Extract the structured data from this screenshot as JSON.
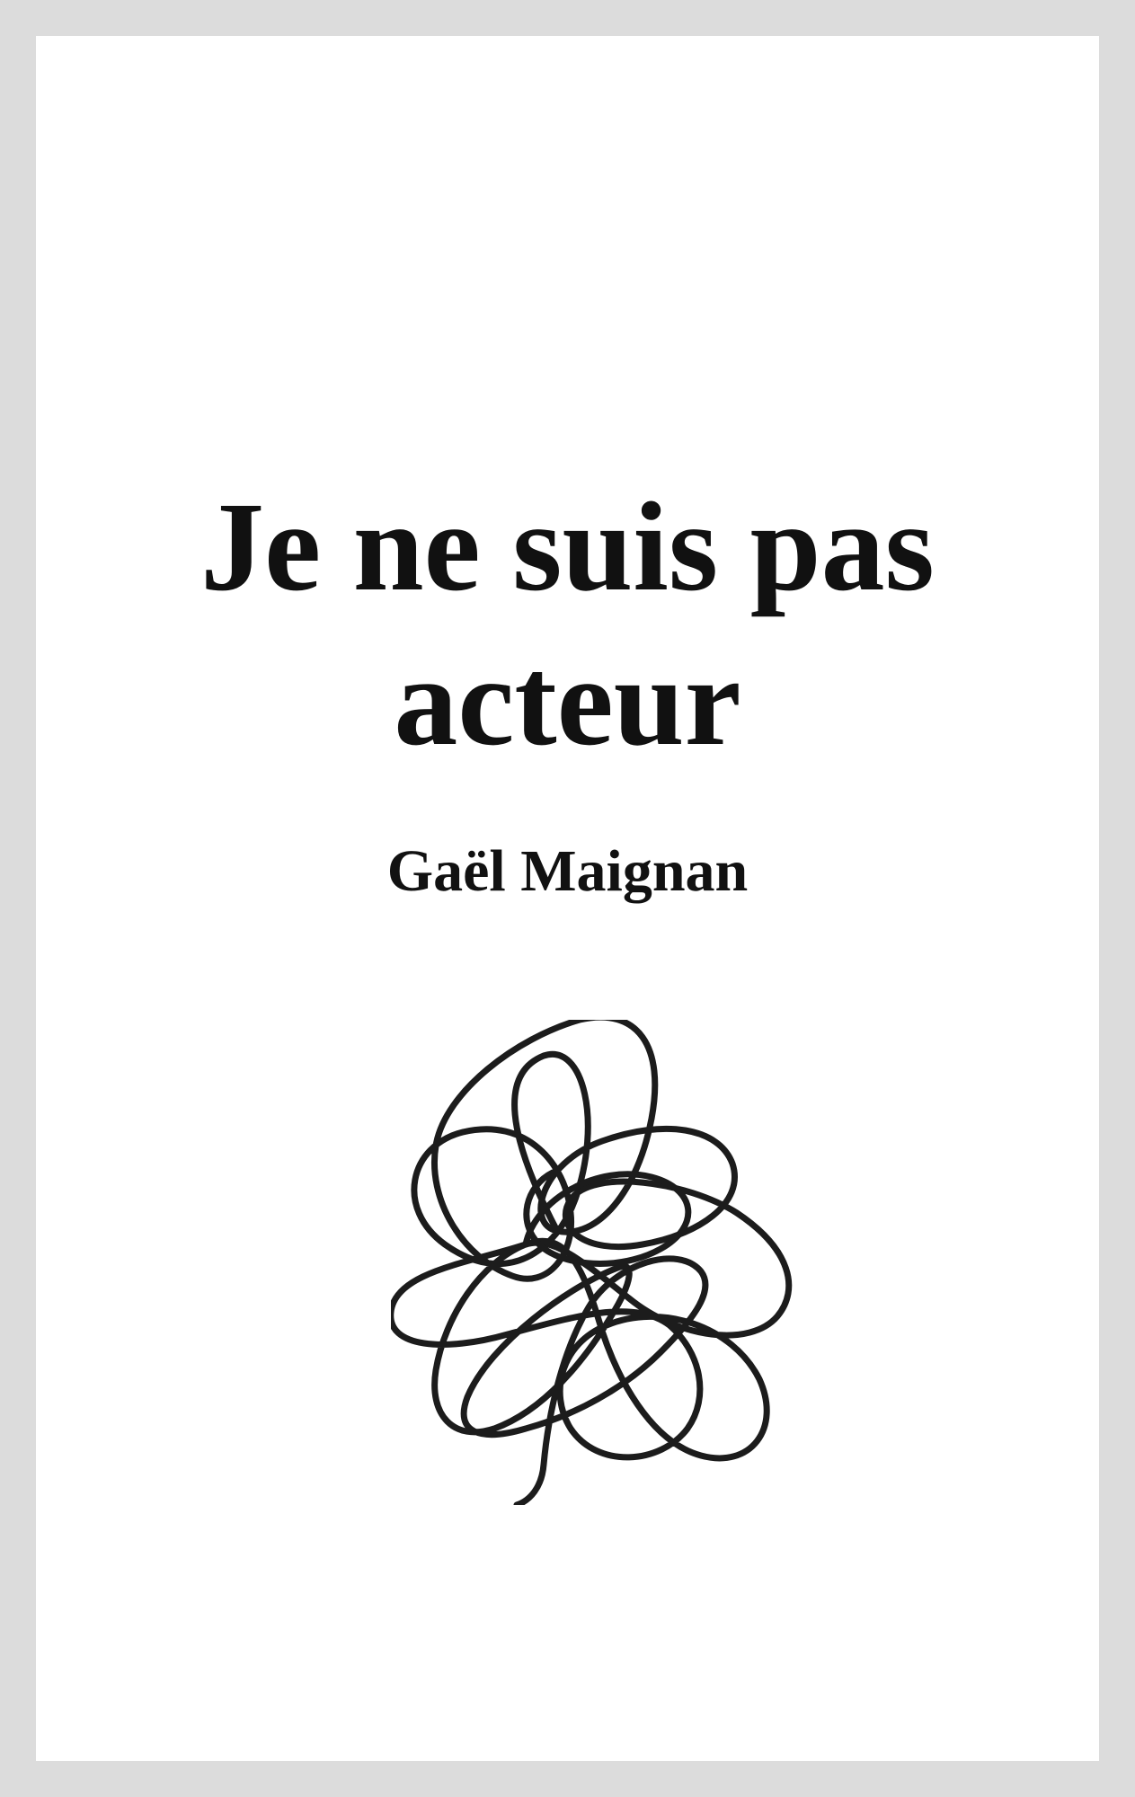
{
  "cover": {
    "title_line1": "Je ne suis pas",
    "title_line2": "acteur",
    "author": "Gaël Maignan",
    "background_color": "#dcdcdc",
    "page_color": "#ffffff",
    "ink_color": "#111111"
  }
}
